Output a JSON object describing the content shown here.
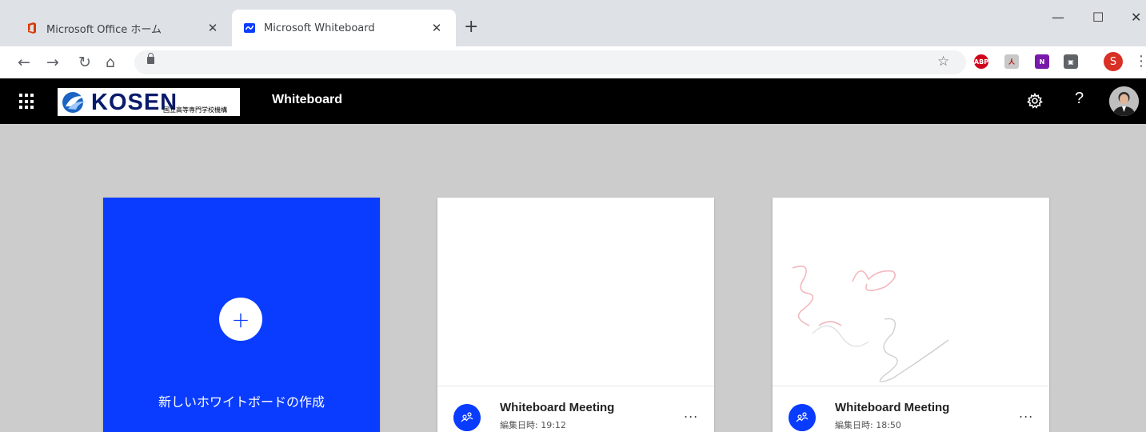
{
  "browser": {
    "tabs": [
      {
        "title": "Microsoft Office ホーム",
        "close": "✕"
      },
      {
        "title": "Microsoft Whiteboard",
        "close": "✕"
      }
    ],
    "new_tab": "+",
    "window_controls": {
      "minimize": "—",
      "maximize": "☐",
      "close": "✕"
    },
    "nav": {
      "back": "←",
      "forward": "→",
      "reload": "↻",
      "home": "⌂"
    },
    "bookmark_star": "☆",
    "extensions": [
      {
        "name": "adblock-plus-icon",
        "label": "ABP",
        "color": "#d0021b"
      },
      {
        "name": "acrobat-icon",
        "label": "人",
        "color": "#c8c8c8"
      },
      {
        "name": "onenote-icon",
        "label": "N",
        "color": "#7719aa"
      },
      {
        "name": "line-icon",
        "label": "▣",
        "color": "#5f6368"
      }
    ],
    "profile_initial": "S",
    "menu": "⋮"
  },
  "header": {
    "logo_text": "KOSEN",
    "logo_subtitle": "国立高等専門学校機構",
    "app_title": "Whiteboard",
    "help": "?"
  },
  "cards": {
    "new_board": {
      "plus": "+",
      "label": "新しいホワイトボードの作成",
      "color": "#0a3cff"
    },
    "boards": [
      {
        "title": "Whiteboard Meeting",
        "date": "編集日時: 19:12",
        "more": "..."
      },
      {
        "title": "Whiteboard Meeting",
        "date": "編集日時: 18:50",
        "more": "..."
      }
    ]
  }
}
